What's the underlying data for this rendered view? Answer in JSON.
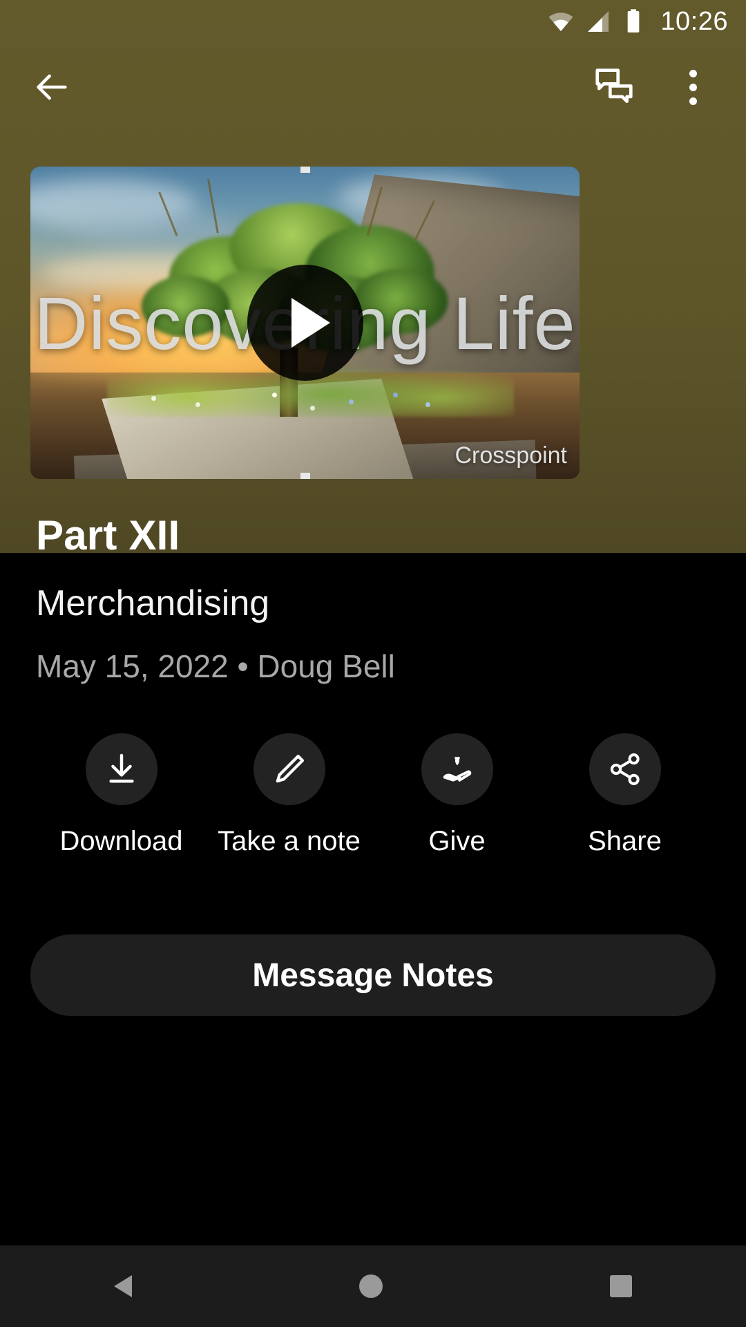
{
  "statusbar": {
    "time": "10:26",
    "icons": [
      "wifi-icon",
      "cellular-signal-icon",
      "battery-icon"
    ]
  },
  "appbar": {
    "back_icon": "back-arrow-icon",
    "chat_icon": "chat-bubbles-icon",
    "overflow_icon": "more-vertical-icon"
  },
  "video": {
    "overlay_title": "Discovering Life",
    "watermark": "Crosspoint",
    "play_icon": "play-icon"
  },
  "details": {
    "title": "Part XII",
    "subtitle": "Merchandising",
    "meta": "May 15, 2022 • Doug Bell"
  },
  "actions": [
    {
      "label": "Download",
      "icon": "download-icon"
    },
    {
      "label": "Take a note",
      "icon": "pencil-icon"
    },
    {
      "label": "Give",
      "icon": "hand-heart-icon"
    },
    {
      "label": "Share",
      "icon": "share-icon"
    }
  ],
  "primary_button": {
    "label": "Message Notes"
  },
  "navbar": {
    "back": "nav-back-icon",
    "home": "nav-home-icon",
    "recents": "nav-recents-icon"
  },
  "colors": {
    "hero_background": "#5d5529",
    "page_background": "#000000",
    "action_circle": "#232323",
    "primary_button": "#1f1f1f",
    "meta_text": "#a8a8a8",
    "navbar": "#1c1c1c"
  }
}
